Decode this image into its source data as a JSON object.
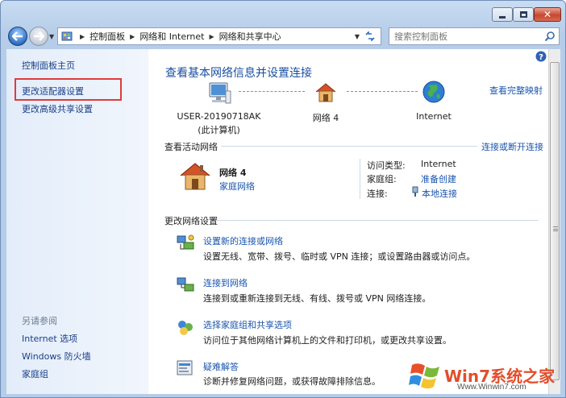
{
  "window": {
    "min_symbol": "",
    "close_symbol": "✕"
  },
  "navbar": {
    "breadcrumbs": [
      "控制面板",
      "网络和 Internet",
      "网络和共享中心"
    ],
    "search_placeholder": "搜索控制面板"
  },
  "sidebar": {
    "home": "控制面板主页",
    "items": [
      "更改适配器设置",
      "更改高级共享设置"
    ],
    "see_also_title": "另请参阅",
    "see_also": [
      "Internet 选项",
      "Windows 防火墙",
      "家庭组"
    ]
  },
  "main": {
    "title": "查看基本网络信息并设置连接",
    "view_full_map": "查看完整映射",
    "map": {
      "computer_name": "USER-20190718AK",
      "computer_sub": "(此计算机)",
      "network_name": "网络  4",
      "internet": "Internet"
    },
    "active_title": "查看活动网络",
    "connect_disconnect": "连接或断开连接",
    "active": {
      "name": "网络  4",
      "type": "家庭网络",
      "access_type_label": "访问类型:",
      "access_type_value": "Internet",
      "homegroup_label": "家庭组:",
      "homegroup_value": "准备创建",
      "connection_label": "连接:",
      "connection_value": "本地连接"
    },
    "change_title": "更改网络设置",
    "tasks": [
      {
        "title": "设置新的连接或网络",
        "desc": "设置无线、宽带、拨号、临时或 VPN 连接；或设置路由器或访问点。"
      },
      {
        "title": "连接到网络",
        "desc": "连接到或重新连接到无线、有线、拨号或 VPN 网络连接。"
      },
      {
        "title": "选择家庭组和共享选项",
        "desc": "访问位于其他网络计算机上的文件和打印机，或更改共享设置。"
      },
      {
        "title": "疑难解答",
        "desc": "诊断并修复网络问题，或获得故障排除信息。"
      }
    ]
  },
  "watermark": {
    "brand": "Win7系统之家",
    "url": "Www.Winwin7.com"
  },
  "colors": {
    "link": "#1a55ad",
    "title": "#1b4fa0",
    "highlight_box": "#e03b3b"
  }
}
